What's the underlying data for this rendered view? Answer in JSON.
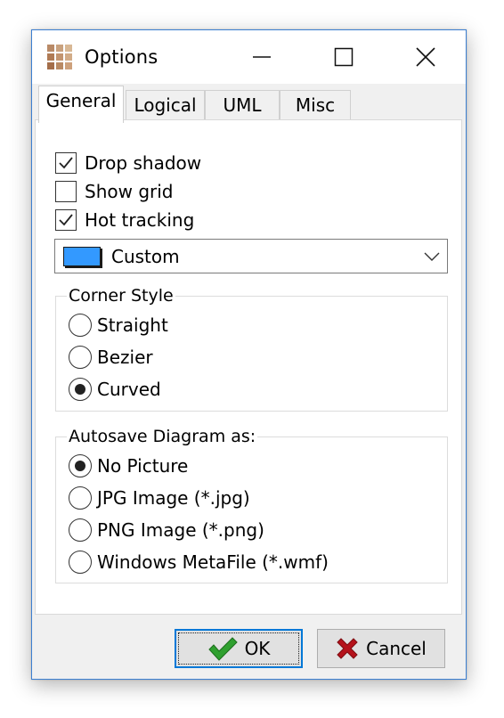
{
  "window": {
    "title": "Options",
    "icon": "grid-app-icon",
    "caption_buttons": [
      "minimize-icon",
      "maximize-icon",
      "close-icon"
    ]
  },
  "tabs": [
    {
      "label": "General",
      "active": true
    },
    {
      "label": "Logical",
      "active": false
    },
    {
      "label": "UML",
      "active": false
    },
    {
      "label": "Misc",
      "active": false
    }
  ],
  "general": {
    "checkboxes": [
      {
        "label": "Drop shadow",
        "checked": true
      },
      {
        "label": "Show grid",
        "checked": false
      },
      {
        "label": "Hot tracking",
        "checked": true
      }
    ],
    "color_combo": {
      "value": "Custom",
      "swatch_color": "#3399ff"
    },
    "corner_style": {
      "legend": "Corner Style",
      "options": [
        {
          "label": "Straight",
          "selected": false
        },
        {
          "label": "Bezier",
          "selected": false
        },
        {
          "label": "Curved",
          "selected": true
        }
      ]
    },
    "autosave": {
      "legend": "Autosave Diagram as:",
      "options": [
        {
          "label": "No Picture",
          "selected": true
        },
        {
          "label": "JPG Image (*.jpg)",
          "selected": false
        },
        {
          "label": "PNG Image (*.png)",
          "selected": false
        },
        {
          "label": "Windows MetaFile (*.wmf)",
          "selected": false
        }
      ]
    }
  },
  "buttons": {
    "ok_label": "OK",
    "cancel_label": "Cancel",
    "ok_icon": "green-check-icon",
    "cancel_icon": "red-x-icon"
  },
  "colors": {
    "accent": "#0078d7",
    "ok_check": "#2fa02f",
    "cancel_x": "#b5121b",
    "window_border": "#3c7fd1"
  }
}
